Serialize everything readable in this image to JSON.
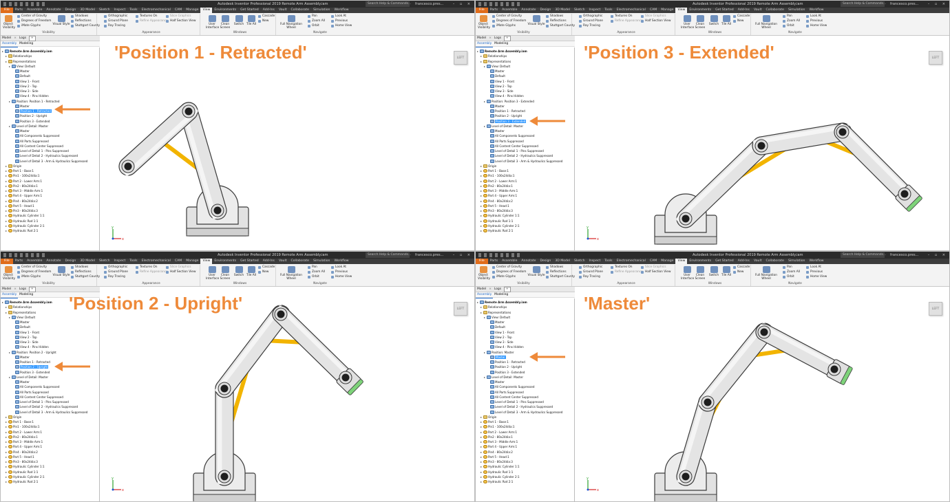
{
  "app": {
    "title": "Autodesk Inventor Professional 2019   Remote Arm Assembly.iam",
    "search_placeholder": "Search Help & Commands...",
    "user": "francesco.pres...",
    "window_controls": "– ▫ ×"
  },
  "ribbon": {
    "tabs": [
      "File",
      "Parts",
      "Assemble",
      "Annotate",
      "Design",
      "3D Model",
      "Sketch",
      "Inspect",
      "Tools",
      "Electromechanical",
      "CAM",
      "Manage",
      "View",
      "Environments",
      "Get Started",
      "Add-Ins",
      "Vault",
      "Collaborate",
      "Simulation",
      "Workflow"
    ],
    "active_tab": "View",
    "visibility": {
      "group_label": "Visibility",
      "object_visibility": "Object Visibility",
      "items": [
        "Center of Gravity",
        "Degrees of Freedom",
        "iMate Glyphs"
      ]
    },
    "appearance": {
      "group_label": "Appearance",
      "visual_style": "Visual Style",
      "col1": [
        "Shadows",
        "Reflections",
        "Stuttgart County"
      ],
      "col2": [
        "Orthographic",
        "Ground Plane",
        "Ray Tracing"
      ],
      "col3": [
        "Textures On",
        "Refine Appearance"
      ],
      "col4": [
        "Slice Graphics",
        "Half Section View"
      ]
    },
    "windows": {
      "group_label": "Windows",
      "buttons": [
        "User Interface",
        "Clean Screen",
        "Switch",
        "Tile All"
      ],
      "small": [
        "Cascade",
        "New"
      ]
    },
    "navigate": {
      "group_label": "Navigate",
      "full_nav": "Full Navigation Wheel",
      "col1": [
        "Pan",
        "Zoom All",
        "Orbit"
      ],
      "col2": [
        "Look At",
        "Previous",
        "Home View"
      ]
    }
  },
  "browser": {
    "header": [
      "Model",
      "×",
      "Logs",
      "+"
    ],
    "tabs": [
      "Assembly",
      "Modeling"
    ],
    "common_rows": [
      {
        "label": "Remote Arm Assembly.iam",
        "depth": 0,
        "kind": "asm",
        "bold": true
      },
      {
        "label": "Relationships",
        "depth": 1,
        "kind": "folder"
      },
      {
        "label": "Representations",
        "depth": 1,
        "kind": "folder"
      },
      {
        "label": "View: Default",
        "depth": 2,
        "kind": "asm"
      },
      {
        "label": "Master",
        "depth": 3,
        "kind": "asm"
      },
      {
        "label": "Default",
        "depth": 3,
        "kind": "asm"
      },
      {
        "label": "View 1 - Front",
        "depth": 3,
        "kind": "asm"
      },
      {
        "label": "View 2 - Top",
        "depth": 3,
        "kind": "asm"
      },
      {
        "label": "View 3 - Side",
        "depth": 3,
        "kind": "asm"
      },
      {
        "label": "View 4 - Pins Hidden",
        "depth": 3,
        "kind": "asm"
      }
    ],
    "position_rows": [
      "Master",
      "Position 1 - Retracted",
      "Position 2 - Upright",
      "Position 3 - Extended"
    ],
    "lod_rows": [
      {
        "label": "Level of Detail: Master",
        "depth": 2,
        "kind": "asm"
      },
      {
        "label": "Master",
        "depth": 3,
        "kind": "asm"
      },
      {
        "label": "All Components Suppressed",
        "depth": 3,
        "kind": "asm"
      },
      {
        "label": "All Parts Suppressed",
        "depth": 3,
        "kind": "asm"
      },
      {
        "label": "All Content Center Suppressed",
        "depth": 3,
        "kind": "asm"
      },
      {
        "label": "Level of Detail 1 - Pins Suppressed",
        "depth": 3,
        "kind": "asm"
      },
      {
        "label": "Level of Detail 2 - Hydraulics Suppressed",
        "depth": 3,
        "kind": "asm"
      },
      {
        "label": "Level of Detail 3 - Arm & Hydraulics Suppressed",
        "depth": 3,
        "kind": "asm"
      },
      {
        "label": "Origin",
        "depth": 1,
        "kind": "folder"
      },
      {
        "label": "Part 1 - Base:1",
        "depth": 1,
        "kind": "part"
      },
      {
        "label": "Pin1 - 100x24dia:1",
        "depth": 1,
        "kind": "part"
      },
      {
        "label": "Part 2 - Lower Arm:1",
        "depth": 1,
        "kind": "part"
      },
      {
        "label": "Pin2 - 80x24dia:1",
        "depth": 1,
        "kind": "part"
      },
      {
        "label": "Part 3 - Middle Arm:1",
        "depth": 1,
        "kind": "part"
      },
      {
        "label": "Part 4 - Upper Arm:1",
        "depth": 1,
        "kind": "part"
      },
      {
        "label": "Pin4 - 80x24dia:2",
        "depth": 1,
        "kind": "part"
      },
      {
        "label": "Part 5 - Head:1",
        "depth": 1,
        "kind": "part"
      },
      {
        "label": "Pin3 - 80x24dia:3",
        "depth": 1,
        "kind": "part"
      },
      {
        "label": "Hydraulic Cylinder 1:1",
        "depth": 1,
        "kind": "part"
      },
      {
        "label": "Hydraulic Rod 1:1",
        "depth": 1,
        "kind": "part"
      },
      {
        "label": "Hydraulic Cylinder 2:1",
        "depth": 1,
        "kind": "part"
      },
      {
        "label": "Hydraulic Rod 2:1",
        "depth": 1,
        "kind": "part"
      }
    ]
  },
  "viewcube_label": "LEFT",
  "axis_labels": {
    "x": "x",
    "y": "y"
  },
  "accent_colors": {
    "file_tab": "#e06c1a",
    "caption": "#ee8a3a",
    "selection": "#3399ff",
    "hydraulic": "#f2b400",
    "head_tip": "#7ed37a"
  },
  "panels": [
    {
      "caption": "'Position 1 - Retracted'",
      "position_header": "Position: Position 1 - Retracted",
      "selected_index": 1,
      "pose": "retracted"
    },
    {
      "caption": "'Position 3 - Extended'",
      "position_header": "Position: Position 3 - Extended",
      "selected_index": 3,
      "pose": "extended"
    },
    {
      "caption": "'Position 2 - Upright'",
      "position_header": "Position: Position 2 - Upright",
      "selected_index": 2,
      "pose": "upright"
    },
    {
      "caption": "'Master'",
      "position_header": "Position: Master",
      "selected_index": 0,
      "pose": "master"
    }
  ]
}
